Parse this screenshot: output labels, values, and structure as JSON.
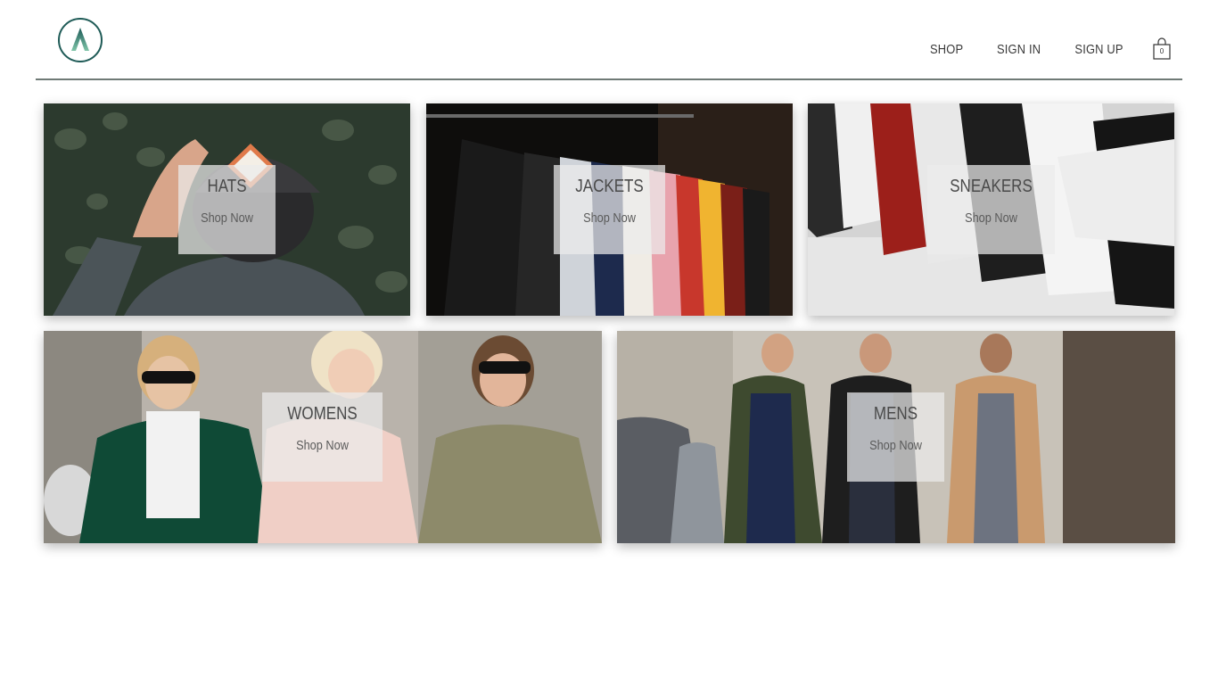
{
  "brand": {
    "logo_icon": "mountain-a-logo-icon",
    "accent": "#1f5b57"
  },
  "nav": {
    "shop": "SHOP",
    "sign_in": "SIGN IN",
    "sign_up": "SIGN UP",
    "cart_icon": "shopping-bag-icon",
    "cart_count": "0"
  },
  "categories": [
    {
      "title": "HATS",
      "cta": "Shop Now"
    },
    {
      "title": "JACKETS",
      "cta": "Shop Now"
    },
    {
      "title": "SNEAKERS",
      "cta": "Shop Now"
    },
    {
      "title": "WOMENS",
      "cta": "Shop Now"
    },
    {
      "title": "MENS",
      "cta": "Shop Now"
    }
  ]
}
